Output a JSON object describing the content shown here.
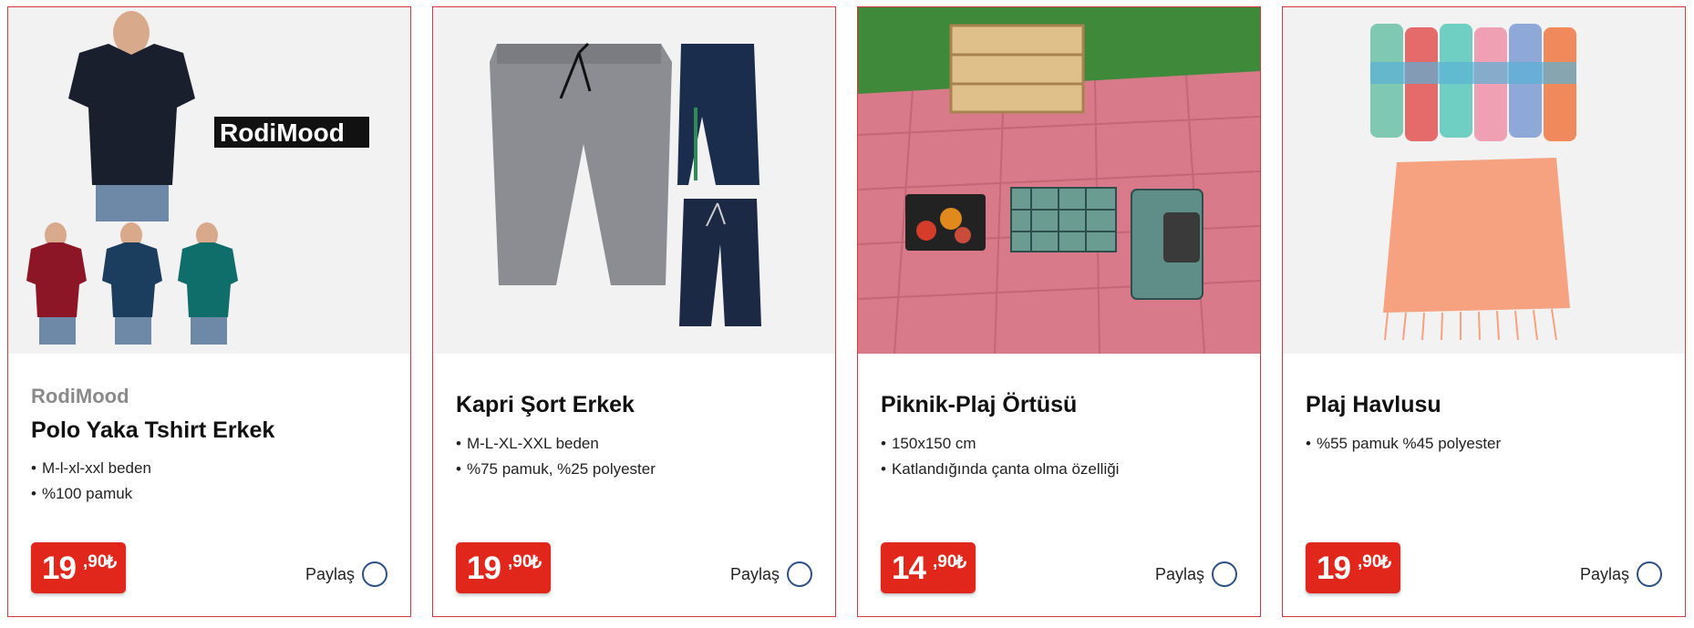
{
  "products": [
    {
      "brand": "RodiMood",
      "image_logo": "RodiMood",
      "title": "Polo Yaka Tshirt Erkek",
      "features": [
        "M-l-xl-xxl beden",
        "%100 pamuk"
      ],
      "price": {
        "integer": "19",
        "decimal": ",90",
        "currency": "₺"
      },
      "share_label": "Paylaş"
    },
    {
      "title": "Kapri Şort Erkek",
      "features": [
        "M-L-XL-XXL beden",
        "%75 pamuk, %25 polyester"
      ],
      "price": {
        "integer": "19",
        "decimal": ",90",
        "currency": "₺"
      },
      "share_label": "Paylaş"
    },
    {
      "title": "Piknik-Plaj Örtüsü",
      "features": [
        "150x150 cm",
        "Katlandığında çanta olma özelliği"
      ],
      "price": {
        "integer": "14",
        "decimal": ",90",
        "currency": "₺"
      },
      "share_label": "Paylaş"
    },
    {
      "title": "Plaj Havlusu",
      "features": [
        "%55 pamuk %45 polyester"
      ],
      "price": {
        "integer": "19",
        "decimal": ",90",
        "currency": "₺"
      },
      "share_label": "Paylaş"
    }
  ],
  "colors": {
    "card_border": "#d9383f",
    "price_badge": "#e1261c",
    "share_circle": "#2b4f86",
    "image_background": "#f2f2f2"
  }
}
